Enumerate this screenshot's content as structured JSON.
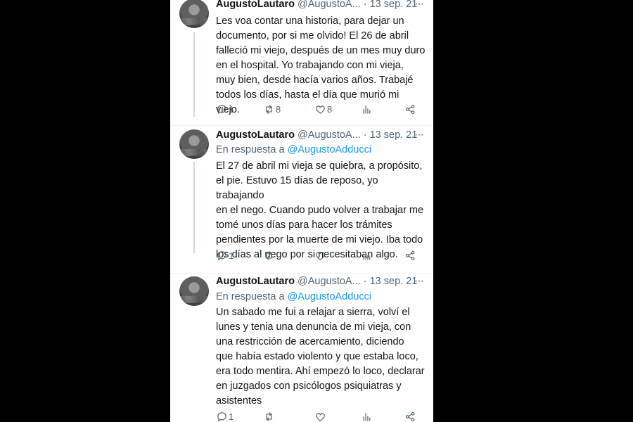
{
  "tweets": [
    {
      "name": "AugustoLautaro",
      "handle": "@AugustoA...",
      "dot": "·",
      "date": "13 sep. 21",
      "more": "···",
      "reply_prefix": "",
      "reply_mention": "",
      "text": "Les voa contar una historia, para dejar un\ndocumento, por si me olvido! El 26 de abril\nfalleció mi viejo, después de un mes muy duro\nen el hospital. Yo trabajando con mi vieja,\nmuy bien, desde hacía varios años. Trabajé\ntodos los días, hasta el día que murió mi viejo.",
      "actions": {
        "replies": "1",
        "retweets": "8",
        "likes": "8"
      }
    },
    {
      "name": "AugustoLautaro",
      "handle": "@AugustoA...",
      "dot": "·",
      "date": "13 sep. 21",
      "more": "···",
      "reply_prefix": "En respuesta a ",
      "reply_mention": "@AugustoAdducci",
      "text": "El 27 de abril mi vieja se quiebra, a propósito,\nel pie. Estuvo 15 días de reposo, yo trabajando\nen el nego. Cuando pudo volver a trabajar me\ntomé unos días para hacer los trámites\npendientes por la muerte de mi viejo. Iba todo\nlos días al nego por si necesitaban algo.",
      "actions": {
        "replies": "1",
        "retweets": "",
        "likes": ""
      }
    },
    {
      "name": "AugustoLautaro",
      "handle": "@AugustoA...",
      "dot": "·",
      "date": "13 sep. 21",
      "more": "···",
      "reply_prefix": "En respuesta a ",
      "reply_mention": "@AugustoAdducci",
      "text": "Un sabado me fui a relajar a sierra, volví el\nlunes y tenia una denuncia de mi vieja, con\nuna restricción de acercamiento, diciendo\nque había estado violento y que estaba loco,\nera todo mentira. Ahí empezó lo loco, declarar\nen juzgados con psicólogos psiquiatras y\nasistentes",
      "actions": {
        "replies": "1",
        "retweets": "",
        "likes": ""
      }
    }
  ],
  "icons": [
    "reply-icon",
    "retweet-icon",
    "like-icon",
    "views-icon",
    "share-icon"
  ],
  "colors": {
    "text": "#0f1419",
    "muted": "#536471",
    "link": "#1d9bf0",
    "background": "#000000"
  }
}
